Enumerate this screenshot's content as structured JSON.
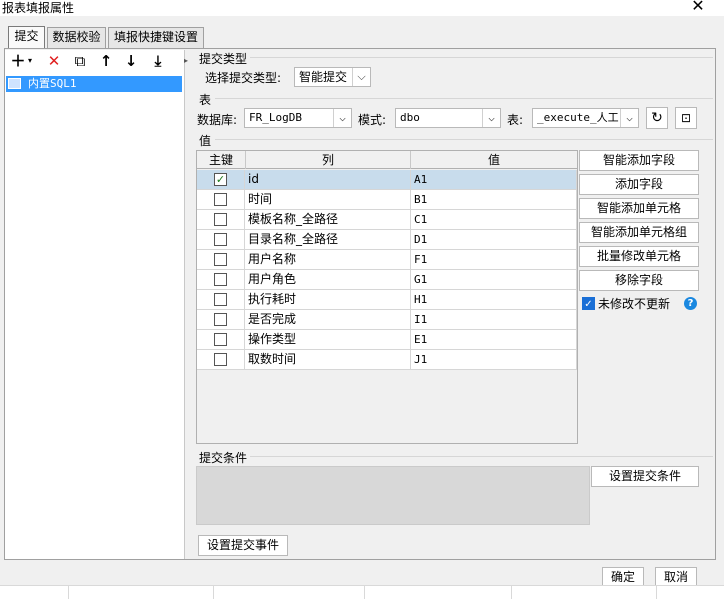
{
  "window": {
    "title": "报表填报属性",
    "close": "✕"
  },
  "tabs": [
    {
      "label": "提交"
    },
    {
      "label": "数据校验"
    },
    {
      "label": "填报快捷键设置"
    }
  ],
  "toolbar": {
    "add": "＋",
    "add_caret": "▾",
    "delete": "✕",
    "copy": "⧉",
    "up": "↑",
    "down": "↓",
    "bottom": "⤓"
  },
  "tree": {
    "items": [
      {
        "label": "内置SQL1"
      }
    ]
  },
  "submit_type": {
    "section_label": "提交类型",
    "field_label": "选择提交类型:",
    "value": "智能提交"
  },
  "table_section": {
    "section_label": "表",
    "database_label": "数据库:",
    "database_value": "FR_LogDB",
    "schema_label": "模式:",
    "schema_value": "dbo",
    "table_label": "表:",
    "table_value": "_execute_人工"
  },
  "values_section": {
    "section_label": "值",
    "columns": {
      "key": "主键",
      "column": "列",
      "value": "值"
    },
    "rows": [
      {
        "checked": true,
        "column": "id",
        "value": "A1"
      },
      {
        "checked": false,
        "column": "时间",
        "value": "B1"
      },
      {
        "checked": false,
        "column": "模板名称_全路径",
        "value": "C1"
      },
      {
        "checked": false,
        "column": "目录名称_全路径",
        "value": "D1"
      },
      {
        "checked": false,
        "column": "用户名称",
        "value": "F1"
      },
      {
        "checked": false,
        "column": "用户角色",
        "value": "G1"
      },
      {
        "checked": false,
        "column": "执行耗时",
        "value": "H1"
      },
      {
        "checked": false,
        "column": "是否完成",
        "value": "I1"
      },
      {
        "checked": false,
        "column": "操作类型",
        "value": "E1"
      },
      {
        "checked": false,
        "column": "取数时间",
        "value": "J1"
      }
    ],
    "buttons": {
      "smart_add_field": "智能添加字段",
      "add_field": "添加字段",
      "smart_add_cell": "智能添加单元格",
      "smart_add_cell_group": "智能添加单元格组",
      "batch_modify_cell": "批量修改单元格",
      "remove_field": "移除字段"
    },
    "no_update_unmodified": {
      "label": "未修改不更新",
      "checked": true
    },
    "help": "?"
  },
  "submit_condition": {
    "section_label": "提交条件",
    "set_button": "设置提交条件"
  },
  "submit_event_button": "设置提交事件",
  "dialog_buttons": {
    "ok": "确定",
    "cancel": "取消"
  },
  "colors": {
    "selection": "#3399ff",
    "row_selected": "#c8dcec",
    "accent": "#1a6fd6"
  }
}
